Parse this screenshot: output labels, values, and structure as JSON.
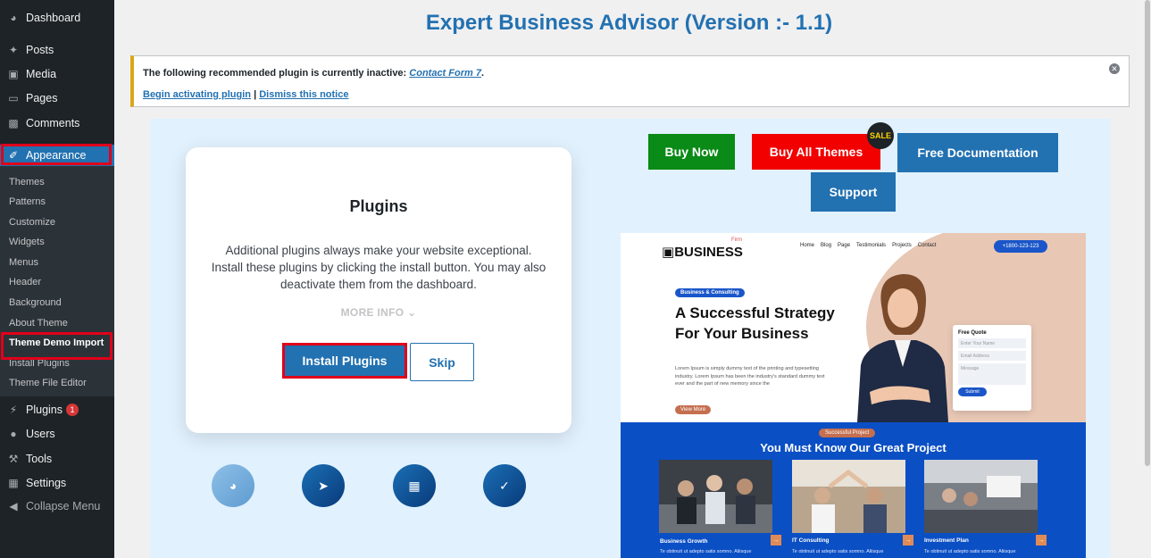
{
  "sidebar": {
    "items": [
      {
        "label": "Dashboard",
        "icon": "dashboard-icon"
      },
      {
        "label": "Posts",
        "icon": "pin-icon"
      },
      {
        "label": "Media",
        "icon": "media-icon"
      },
      {
        "label": "Pages",
        "icon": "pages-icon"
      },
      {
        "label": "Comments",
        "icon": "comment-icon"
      },
      {
        "label": "Appearance",
        "icon": "brush-icon"
      }
    ],
    "submenu": [
      "Themes",
      "Patterns",
      "Customize",
      "Widgets",
      "Menus",
      "Header",
      "Background",
      "About Theme",
      "Theme Demo Import",
      "Install Plugins",
      "Theme File Editor"
    ],
    "bottom": [
      {
        "label": "Plugins",
        "icon": "plugin-icon",
        "badge": "1"
      },
      {
        "label": "Users",
        "icon": "user-icon"
      },
      {
        "label": "Tools",
        "icon": "wrench-icon"
      },
      {
        "label": "Settings",
        "icon": "settings-icon"
      },
      {
        "label": "Collapse Menu",
        "icon": "collapse-icon"
      }
    ]
  },
  "page_title": "Expert Business Advisor (Version :- 1.1)",
  "notice": {
    "text": "The following recommended plugin is currently inactive: ",
    "plugin_link": "Contact Form 7",
    "suffix": ".",
    "activate_link": "Begin activating plugin",
    "separator": " | ",
    "dismiss_link": "Dismiss this notice"
  },
  "card": {
    "title": "Plugins",
    "description": "Additional plugins always make your website exceptional. Install these plugins by clicking the install button. You may also deactivate them from the dashboard.",
    "more_info": "MORE INFO",
    "install_button": "Install Plugins",
    "skip_button": "Skip"
  },
  "top_buttons": {
    "buy_now": "Buy Now",
    "buy_all": "Buy All Themes",
    "sale": "SALE",
    "docs": "Free Documentation",
    "support": "Support"
  },
  "colors": {
    "buy_now": "#0a8a16",
    "buy_all": "#f20000",
    "docs": "#2271b1",
    "support": "#2271b1",
    "accent": "#2271b1"
  },
  "preview": {
    "logo": "BUSINESS",
    "logo_tag": "Firm",
    "nav": [
      "Home",
      "Blog",
      "Page",
      "Testimonials",
      "Projects",
      "Contact"
    ],
    "phone": "+1800-123-123",
    "tag": "Business & Consulting",
    "headline": "A Successful Strategy For Your Business",
    "body": "Lorem Ipsum is simply dummy text of the printing and typesetting industry. Lorem Ipsum has been the industry's standard dummy text ever and the part of new memory since the",
    "view_more": "View More",
    "form_title": "Free Quote",
    "form_name": "Enter Your Name",
    "form_email": "Email Address",
    "form_message": "Message",
    "form_submit": "Submit",
    "projects_tag": "Successful Project",
    "projects_title": "You Must Know Our Great Project",
    "projects": [
      {
        "name": "Business Growth",
        "desc": "Te obtinuit ut adepto satis somno. Aliisque"
      },
      {
        "name": "IT Consulting",
        "desc": "Te obtinuit ut adepto satis somno. Aliisque"
      },
      {
        "name": "Investment Plan",
        "desc": "Te obtinuit ut adepto satis somno. Aliisque"
      }
    ]
  }
}
